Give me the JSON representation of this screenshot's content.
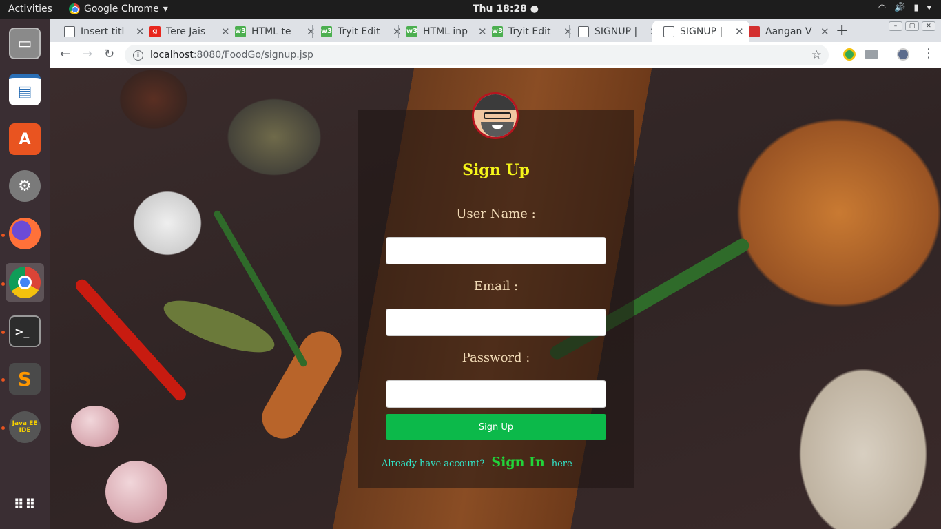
{
  "topbar": {
    "activities": "Activities",
    "app_name": "Google Chrome",
    "clock": "Thu 18:28"
  },
  "dock": {
    "items": [
      {
        "name": "files-icon",
        "color": "#8a8a8a"
      },
      {
        "name": "libreoffice-impress-icon",
        "color": "#2a6fb6"
      },
      {
        "name": "ubuntu-software-icon",
        "color": "#e95420"
      },
      {
        "name": "system-settings-icon",
        "color": "#7a7a7a"
      },
      {
        "name": "firefox-icon",
        "color": "#ff7139"
      },
      {
        "name": "chrome-icon",
        "color": "#4285f4"
      },
      {
        "name": "terminal-icon",
        "color": "#2c2c2c"
      },
      {
        "name": "sublime-text-icon",
        "color": "#ff9800"
      },
      {
        "name": "java-ee-ide-icon",
        "color": "#555555"
      },
      {
        "name": "show-applications-icon",
        "color": "#ffffff"
      }
    ],
    "java_label": "Java EE IDE"
  },
  "tabs": [
    {
      "title": "Insert titl",
      "favicon": "page",
      "active": false
    },
    {
      "title": "Tere Jais",
      "favicon": "g",
      "active": false
    },
    {
      "title": "HTML te",
      "favicon": "w3",
      "active": false
    },
    {
      "title": "Tryit Edit",
      "favicon": "w3",
      "active": false
    },
    {
      "title": "HTML inp",
      "favicon": "w3",
      "active": false
    },
    {
      "title": "Tryit Edit",
      "favicon": "w3",
      "active": false
    },
    {
      "title": "SIGNUP |",
      "favicon": "page",
      "active": false
    },
    {
      "title": "SIGNUP |",
      "favicon": "page",
      "active": true
    },
    {
      "title": "Aangan V",
      "favicon": "red",
      "active": false
    }
  ],
  "omnibox": {
    "host": "localhost",
    "path": ":8080/FoodGo/signup.jsp"
  },
  "form": {
    "title": "Sign Up",
    "username_label": "User Name :",
    "email_label": "Email :",
    "password_label": "Password :",
    "username_value": "",
    "email_value": "",
    "password_value": "",
    "submit_label": "Sign Up",
    "footer_prefix": "Already have account?",
    "footer_link": "Sign In",
    "footer_suffix": "here"
  },
  "colors": {
    "title": "#f5f51a",
    "button": "#0cb94a",
    "link": "#22d33a",
    "footer_text": "#31e6c9"
  }
}
